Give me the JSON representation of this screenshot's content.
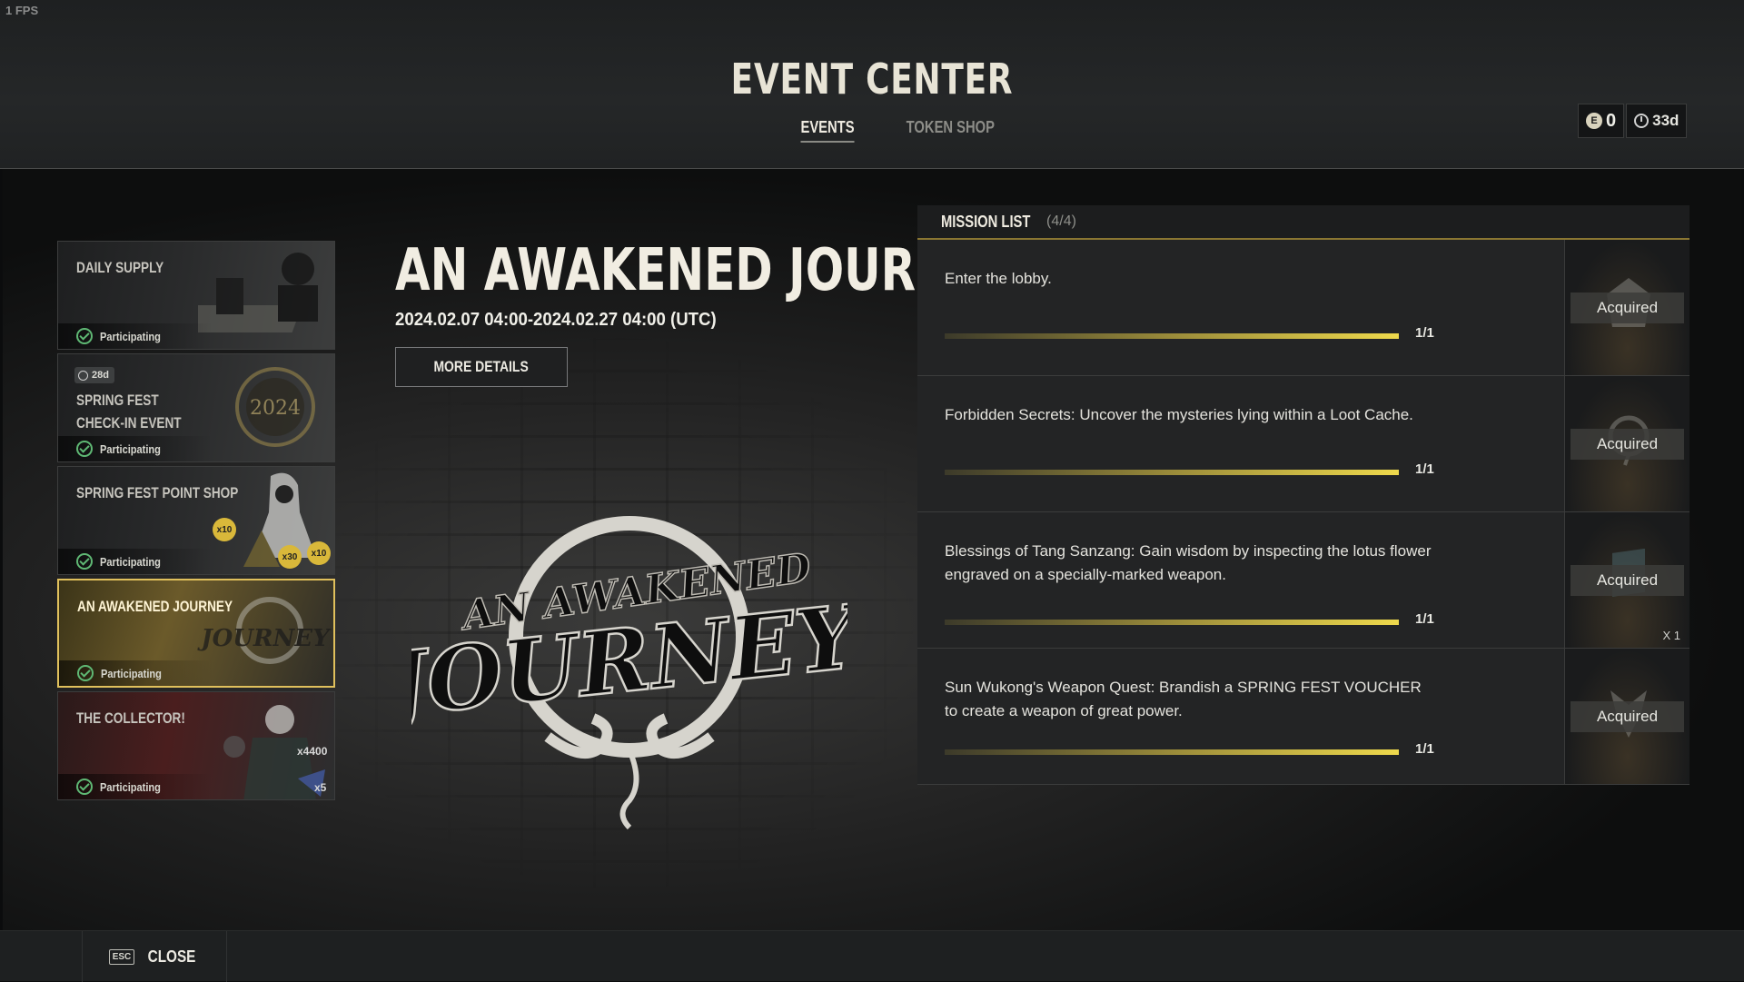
{
  "fps": "1 FPS",
  "header": {
    "title": "EVENT CENTER",
    "tabs": [
      {
        "label": "EVENTS",
        "active": true
      },
      {
        "label": "TOKEN SHOP",
        "active": false
      }
    ],
    "currency": {
      "icon": "e-coin-icon",
      "value": "0",
      "time_icon": "clock-icon",
      "time_left": "33d"
    }
  },
  "events": [
    {
      "title": "DAILY SUPPLY",
      "status": "Participating"
    },
    {
      "title": "SPRING FEST CHECK-IN EVENT",
      "status": "Participating",
      "days": "28d",
      "art_text": "2024"
    },
    {
      "title": "SPRING FEST POINT SHOP",
      "status": "Participating",
      "badges": [
        "x10",
        "x30",
        "x10"
      ]
    },
    {
      "title": "AN AWAKENED JOURNEY",
      "status": "Participating",
      "selected": true
    },
    {
      "title": "THE COLLECTOR!",
      "status": "Participating",
      "qty1": "x4400",
      "qty2": "x5"
    }
  ],
  "detail": {
    "title": "AN AWAKENED JOURNEY",
    "dates": "2024.02.07 04:00-2024.02.27 04:00 (UTC)",
    "more_details": "MORE DETAILS",
    "logo_line1": "AN AWAKENED",
    "logo_line2": "JOURNEY"
  },
  "missions": {
    "label": "MISSION LIST",
    "count": "(4/4)",
    "items": [
      {
        "text": "Enter the lobby.",
        "progress": 1.0,
        "progress_label": "1/1",
        "reward_status": "Acquired",
        "reward_qty": ""
      },
      {
        "text": "Forbidden Secrets: Uncover the mysteries lying within a Loot Cache.",
        "progress": 1.0,
        "progress_label": "1/1",
        "reward_status": "Acquired",
        "reward_qty": ""
      },
      {
        "text": "Blessings of Tang Sanzang: Gain wisdom by inspecting the lotus flower engraved on a specially-marked weapon.",
        "progress": 1.0,
        "progress_label": "1/1",
        "reward_status": "Acquired",
        "reward_qty": "X 1"
      },
      {
        "text": "Sun Wukong's Weapon Quest: Brandish a SPRING FEST VOUCHER to create a weapon of great power.",
        "progress": 1.0,
        "progress_label": "1/1",
        "reward_status": "Acquired",
        "reward_qty": ""
      }
    ]
  },
  "footer": {
    "esc_key": "ESC",
    "close_label": "CLOSE"
  }
}
